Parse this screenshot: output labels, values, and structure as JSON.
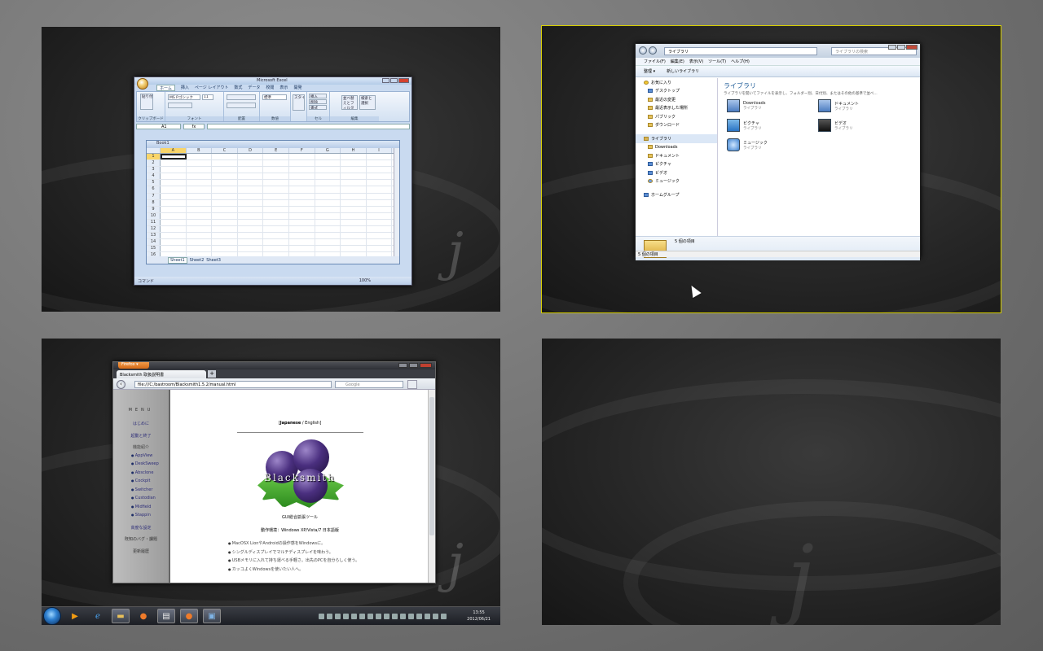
{
  "excel": {
    "title": "Microsoft Excel",
    "tabs": [
      "ホーム",
      "挿入",
      "ページ レイアウト",
      "数式",
      "データ",
      "校閲",
      "表示",
      "開発"
    ],
    "ribbon": {
      "paste": "貼り付け",
      "font_name": "MS Pゴシック",
      "font_size": "11",
      "number_format": "標準",
      "style": "スタイル",
      "insert": "挿入",
      "delete": "削除",
      "format": "書式",
      "sort_filter": "並べ替えとフィルタ",
      "find_select": "検索と選択",
      "groups": [
        "クリップボード",
        "フォント",
        "配置",
        "数値",
        "セル",
        "編集"
      ]
    },
    "name_box": "A1",
    "fx": "fx",
    "book_title": "Book1",
    "columns": [
      "A",
      "B",
      "C",
      "D",
      "E",
      "F",
      "G",
      "H",
      "I"
    ],
    "rows": [
      "1",
      "2",
      "3",
      "4",
      "5",
      "6",
      "7",
      "8",
      "9",
      "10",
      "11",
      "12",
      "13",
      "14",
      "15",
      "16"
    ],
    "sheets": [
      "Sheet1",
      "Sheet2",
      "Sheet3"
    ],
    "status": "コマンド",
    "zoom": "100%"
  },
  "explorer": {
    "address": "ライブラリ",
    "search_placeholder": "ライブラリの検索",
    "menu": [
      "ファイル(F)",
      "編集(E)",
      "表示(V)",
      "ツール(T)",
      "ヘルプ(H)"
    ],
    "commands": [
      "整理 ▾",
      "新しいライブラリ"
    ],
    "nav_favorites": "お気に入り",
    "nav_fav_items": [
      "デスクトップ",
      "最近の変更",
      "最近表示した場所",
      "パブリック",
      "ダウンロード"
    ],
    "nav_libraries": "ライブラリ",
    "nav_lib_items": [
      "Downloads",
      "ドキュメント",
      "ピクチャ",
      "ビデオ",
      "ミュージック"
    ],
    "nav_homegroup": "ホームグループ",
    "heading": "ライブラリ",
    "subheading": "ライブラリを開いてファイルを表示し、フォルダー別、日付別、またはその他の基準で並べ...",
    "libraries": [
      {
        "name": "Downloads",
        "type": "ライブラリ"
      },
      {
        "name": "ドキュメント",
        "type": "ライブラリ"
      },
      {
        "name": "ピクチャ",
        "type": "ライブラリ"
      },
      {
        "name": "ビデオ",
        "type": "ライブラリ"
      },
      {
        "name": "ミュージック",
        "type": "ライブラリ"
      }
    ],
    "details_count": "5 個の項目",
    "status": "5 個の項目"
  },
  "firefox": {
    "button": "Firefox ▾",
    "tab_title": "Blacksmith 取扱説明書",
    "url": "file:///C:/bastroom/Blacksmith1.5.2/manual.html",
    "search_engine": "Google",
    "menu_title": "MENU",
    "menu_items": [
      "はじめに",
      "起動と終了",
      "機能紹介"
    ],
    "features": [
      "AppView",
      "DeskSweep",
      "Absclone",
      "Cockpit",
      "Switcher",
      "Custodian",
      "Midfield",
      "Stappin"
    ],
    "menu_items2": [
      "高度な設定",
      "既知のバグ・課題",
      "更新履歴"
    ],
    "lang_open": "[",
    "lang_ja": "Japanese",
    "lang_sep": "/",
    "lang_en": "English",
    "lang_close": "]",
    "logo_text": "Blacksmith",
    "tagline": "GUI総合拡張ツール",
    "environment": "動作環境：Windows XP/Vista/7 日本語版",
    "bullets": [
      "MacOSX LionやAndroidの操作感をWindowsに。",
      "シングルディスプレイでマルチディスプレイを味わう。",
      "USBメモリに入れて持ち運べる手軽さ。出先のPCを自分らしく使う。",
      "カッコよくWindowsを使いたい人へ。"
    ]
  },
  "taskbar": {
    "time": "13:55",
    "date": "2012/06/21"
  }
}
